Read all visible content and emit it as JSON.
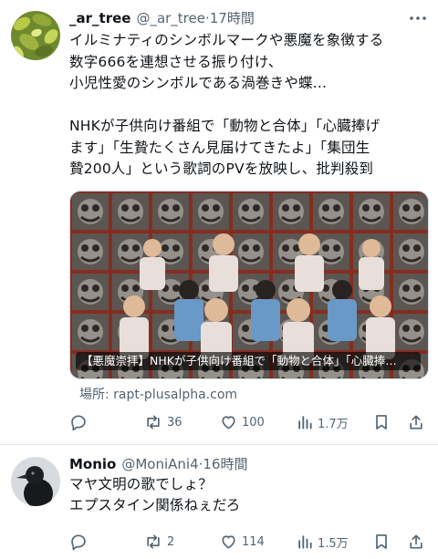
{
  "posts": [
    {
      "author_name": "_ar_tree",
      "handle": "@_ar_tree",
      "separator": "·",
      "time": "17時間",
      "text": "イルミナティのシンボルマークや悪魔を象徴する\n数字666を連想させる振り付け、\n小児性愛のシンボルである渦巻きや蝶...\n\nNHKが子供向け番組で「動物と合体」「心臓捧げ\nます」「生贄たくさん見届けてきたよ」「集団生\n贄200人」という歌詞のPVを放映し、批判殺到",
      "card_title": "【悪魔崇拝】NHKが子供向け番組で「動物と合体」「心臓捧…",
      "source": "場所: rapt-plusalpha.com",
      "replies": "",
      "reposts": "36",
      "likes": "100",
      "views": "1.7万"
    },
    {
      "author_name": "Monio",
      "handle": "@MoniAni4",
      "separator": "·",
      "time": "16時間",
      "text": "マヤ文明の歌でしょ？\nエプスタイン関係ねぇだろ",
      "replies": "",
      "reposts": "2",
      "likes": "114",
      "views": "1.5万"
    }
  ],
  "icons": [
    "reply-icon",
    "repost-icon",
    "like-icon",
    "views-icon",
    "bookmark-icon",
    "share-icon",
    "more-icon"
  ],
  "colors": {
    "text": "#0f1419",
    "secondary": "#536471",
    "divider": "#e6e9ec"
  }
}
